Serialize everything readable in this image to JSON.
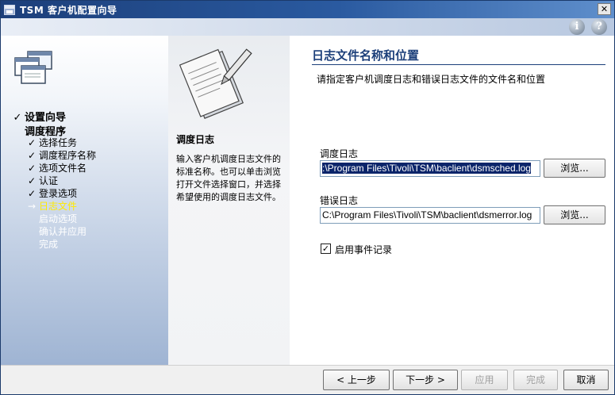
{
  "window": {
    "title": "TSM 客户机配置向导"
  },
  "toolbar": {
    "info_glyph": "i",
    "help_glyph": "?"
  },
  "nav": {
    "top1": {
      "mark": "✓",
      "label": "设置向导"
    },
    "top2": {
      "label": "调度程序"
    },
    "items": [
      {
        "mark": "✓",
        "label": "选择任务",
        "state": "done"
      },
      {
        "mark": "✓",
        "label": "调度程序名称",
        "state": "done"
      },
      {
        "mark": "✓",
        "label": "选项文件名",
        "state": "done"
      },
      {
        "mark": "✓",
        "label": "认证",
        "state": "done"
      },
      {
        "mark": "✓",
        "label": "登录选项",
        "state": "done"
      },
      {
        "mark": "→",
        "label": "日志文件",
        "state": "current"
      },
      {
        "mark": "",
        "label": "启动选项",
        "state": "pending"
      },
      {
        "mark": "",
        "label": "确认并应用",
        "state": "pending"
      },
      {
        "mark": "",
        "label": "完成",
        "state": "pending"
      }
    ]
  },
  "description": {
    "title": "调度日志",
    "body": "输入客户机调度日志文件的标准名称。也可以单击浏览打开文件选择窗口，并选择希望使用的调度日志文件。"
  },
  "main": {
    "title": "日志文件名称和位置",
    "subtitle": "请指定客户机调度日志和错误日志文件的文件名和位置",
    "sched_label": "调度日志",
    "sched_value": ":\\Program Files\\Tivoli\\TSM\\baclient\\dsmsched.log",
    "error_label": "错误日志",
    "error_value": "C:\\Program Files\\Tivoli\\TSM\\baclient\\dsmerror.log",
    "browse_label": "浏览...",
    "event_log_label": "启用事件记录",
    "event_log_checked": true
  },
  "footer": {
    "back": "< 上一步",
    "next": "下一步 >",
    "apply": "应用",
    "finish": "完成",
    "cancel": "取消"
  },
  "colors": {
    "title_bar": "#1c3f7a",
    "current_step": "#ffea00",
    "selection": "#0a246a"
  }
}
